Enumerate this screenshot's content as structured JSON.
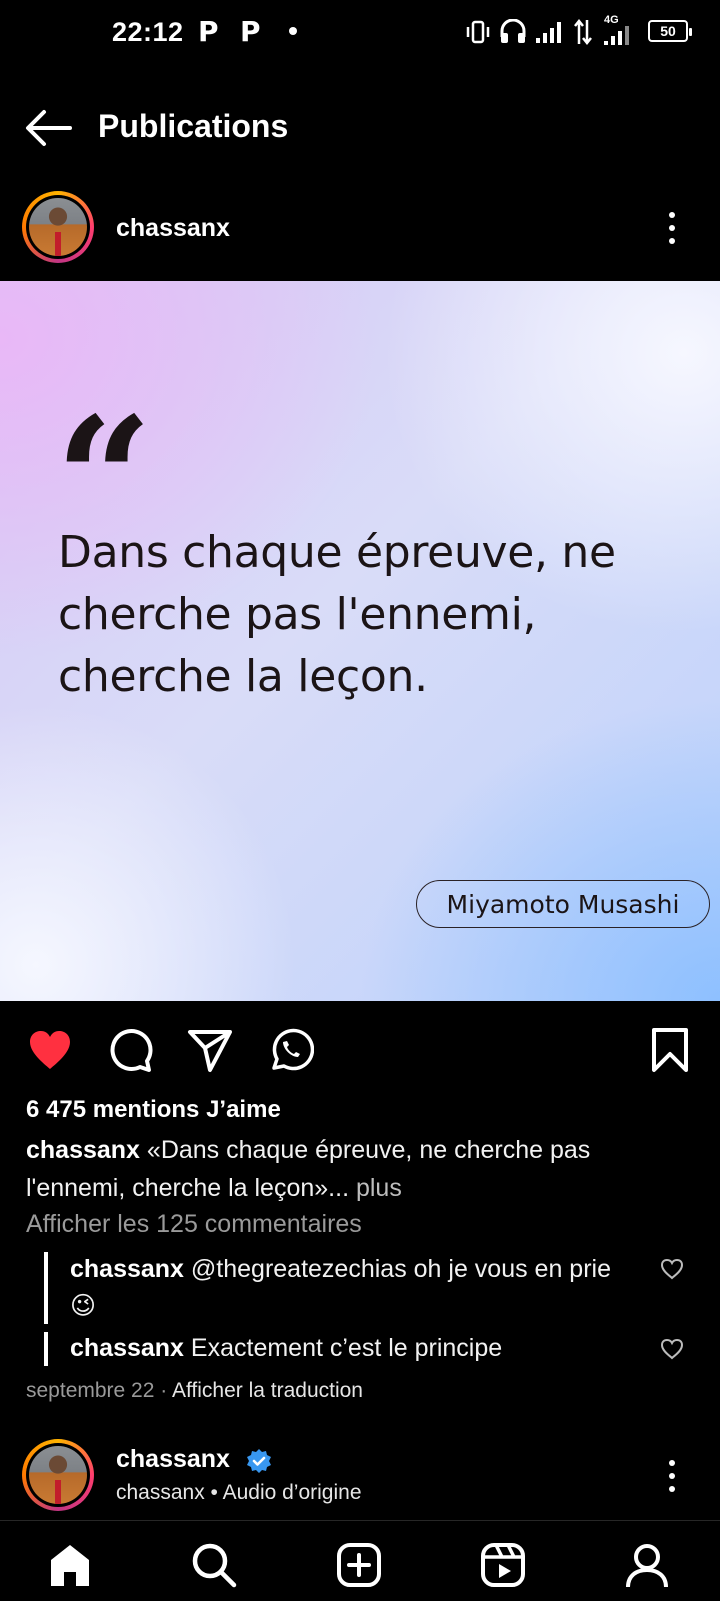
{
  "status_bar": {
    "time": "22:12",
    "notif1": "P",
    "notif2": "P",
    "network": "4G",
    "battery": "50"
  },
  "header": {
    "back_icon": "arrow-left-icon",
    "title": "Publications"
  },
  "post": {
    "username": "chassanx",
    "image": {
      "quote_mark": "“",
      "quote_text": "Dans chaque épreuve, ne cherche pas l'ennemi, cherche la leçon.",
      "author": "Miyamoto Musashi"
    },
    "actions": {
      "like_icon": "heart-filled-icon",
      "comment_icon": "comment-icon",
      "share_icon": "send-icon",
      "whatsapp_icon": "whatsapp-icon",
      "save_icon": "bookmark-icon",
      "like_color": "#ff3040"
    },
    "likes": "6 475 mentions J’aime",
    "caption_user": "chassanx",
    "caption_text": " «Dans chaque épreuve, ne cherche pas l'ennemi, cherche la leçon»...",
    "caption_more": " plus",
    "view_all_comments": "Afficher les 125 commentaires",
    "comments": [
      {
        "user": "chassanx",
        "text": " @thegreatezechias oh je vous en prie",
        "emoji": "😉"
      },
      {
        "user": "chassanx",
        "text": " Exactement c’est le principe",
        "emoji": ""
      }
    ],
    "date": "septembre 22",
    "separator": " · ",
    "translate": "Afficher la traduction"
  },
  "next_post": {
    "username": "chassanx",
    "verified_icon": "verified-badge-icon",
    "verified_color": "#3897f0",
    "subtitle": "chassanx • Audio d’origine"
  },
  "bottom_nav": {
    "items": [
      "home-icon",
      "search-icon",
      "create-icon",
      "reels-icon",
      "profile-icon"
    ]
  }
}
